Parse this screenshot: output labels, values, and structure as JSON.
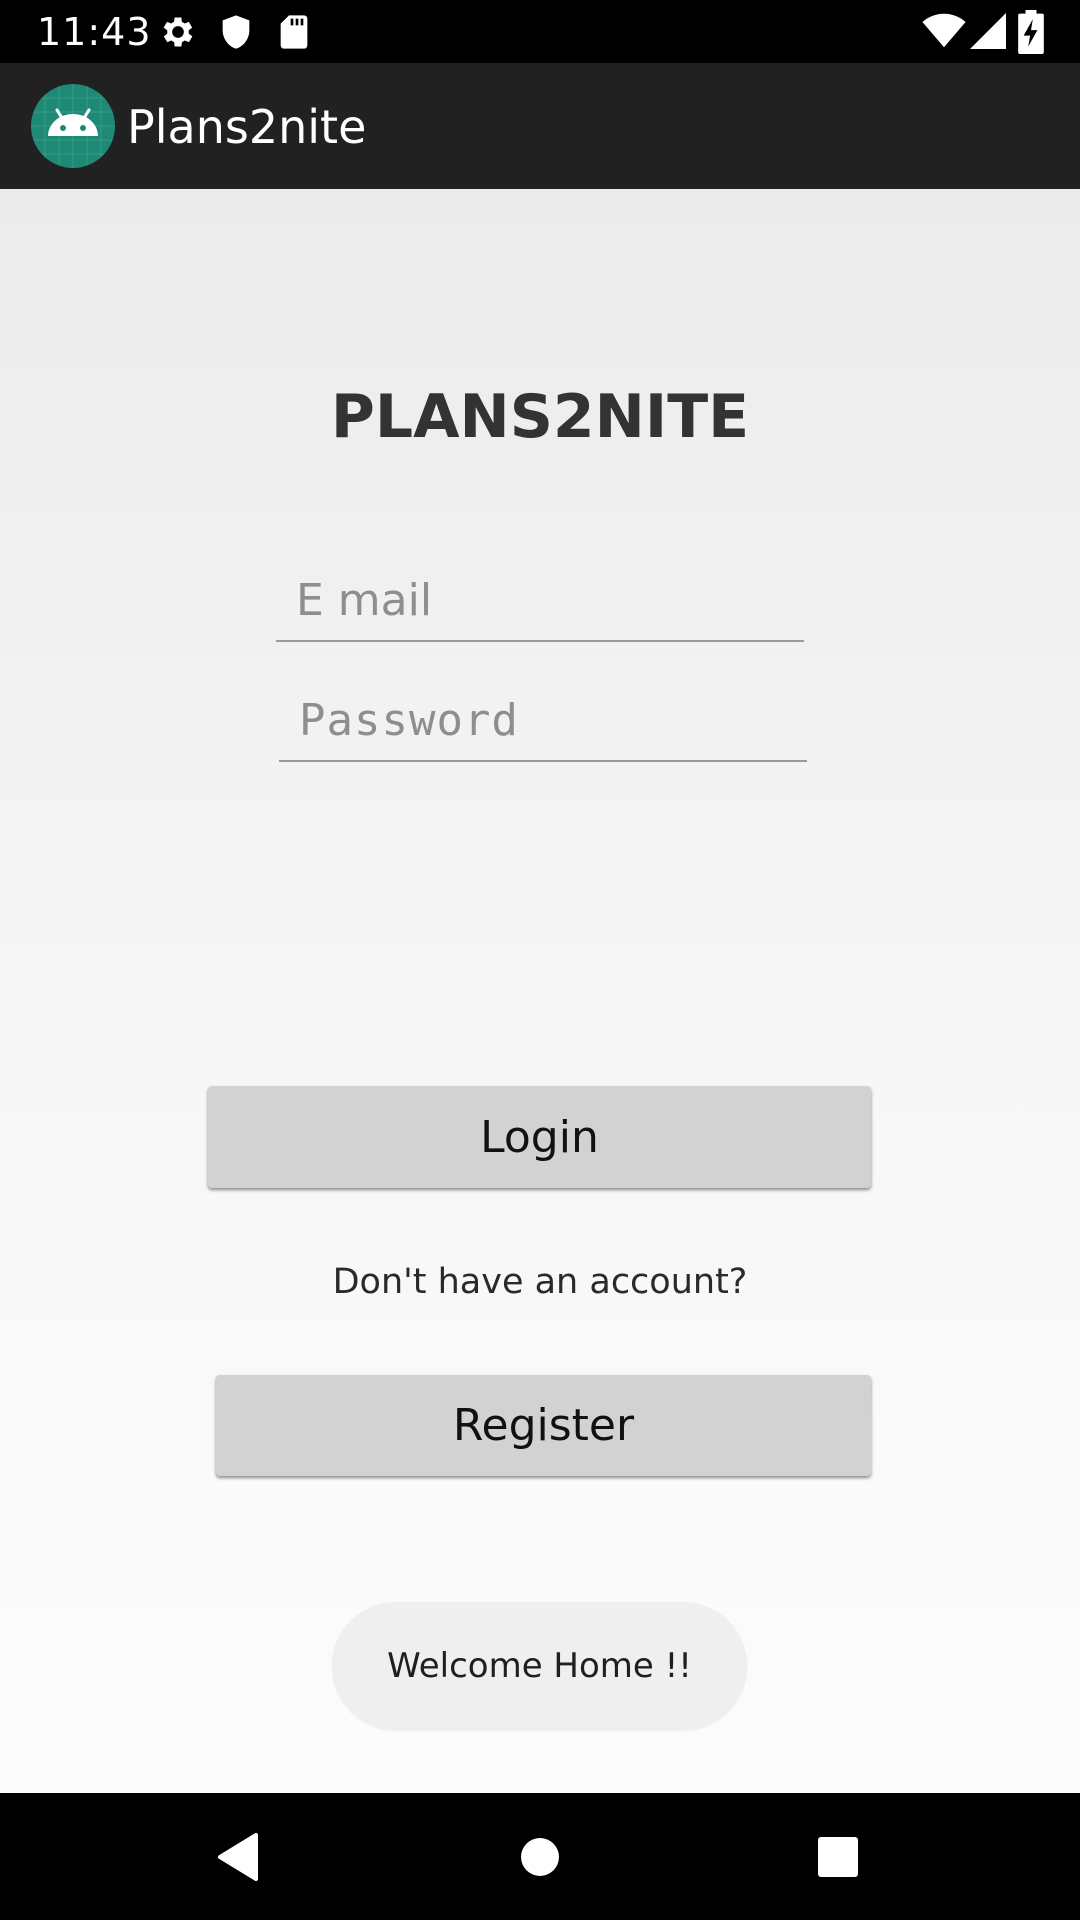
{
  "status_bar": {
    "time": "11:43",
    "icons_left": [
      "gear-icon",
      "shield-icon",
      "sd-card-icon"
    ],
    "icons_right": [
      "wifi-icon",
      "signal-icon",
      "battery-charging-icon"
    ]
  },
  "app_bar": {
    "title": "Plans2nite",
    "logo_icon": "android-icon"
  },
  "login": {
    "heading": "PLANS2NITE",
    "email_placeholder": "E mail",
    "email_value": "",
    "password_placeholder": "Password",
    "password_value": "",
    "login_label": "Login",
    "no_account_text": "Don't have an account?",
    "register_label": "Register"
  },
  "toast": {
    "message": "Welcome Home !!"
  },
  "nav_bar": {
    "buttons": [
      "back-icon",
      "home-icon",
      "recents-icon"
    ]
  },
  "colors": {
    "status_bar": "#000000",
    "app_bar": "#212121",
    "logo_bg": "#1e8a76",
    "button_bg": "#d2d2d2",
    "toast_bg": "#efefef"
  }
}
